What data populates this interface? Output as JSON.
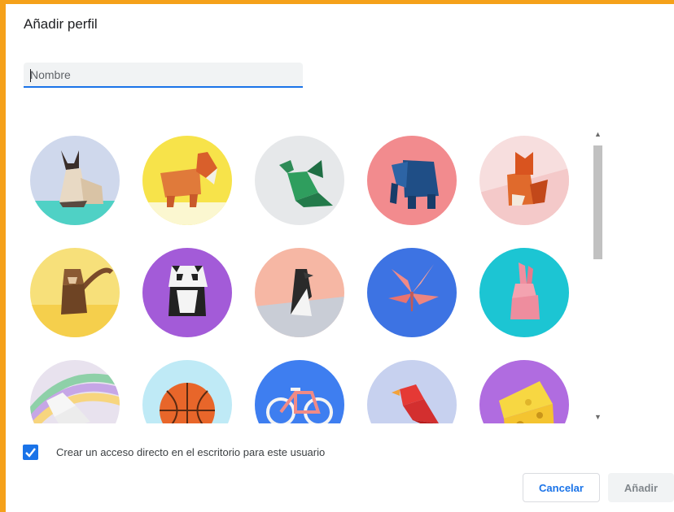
{
  "dialog": {
    "title": "Añadir perfil",
    "name_field": {
      "placeholder": "Nombre",
      "value": ""
    }
  },
  "avatar_grid": {
    "avatars": [
      {
        "icon": "origami-cat-icon",
        "background": "#cfd8ec"
      },
      {
        "icon": "origami-corgi-icon",
        "background": "#f7e34a"
      },
      {
        "icon": "origami-dragon-icon",
        "background": "#e6e8ea"
      },
      {
        "icon": "origami-elephant-icon",
        "background": "#f28b8e"
      },
      {
        "icon": "origami-fox-icon",
        "background": "#f7dede"
      },
      {
        "icon": "origami-monkey-icon",
        "background": "#f7e07a"
      },
      {
        "icon": "origami-panda-icon",
        "background": "#a35bd8"
      },
      {
        "icon": "origami-penguin-icon",
        "background": "#f6b7a4"
      },
      {
        "icon": "origami-butterfly-icon",
        "background": "#3d73e3"
      },
      {
        "icon": "origami-rabbit-icon",
        "background": "#1cc5d3"
      },
      {
        "icon": "origami-unicorn-icon",
        "background": "#e8e2ee"
      },
      {
        "icon": "origami-basketball-icon",
        "background": "#bfeaf6"
      },
      {
        "icon": "origami-bicycle-icon",
        "background": "#3e7ef0"
      },
      {
        "icon": "origami-bird-icon",
        "background": "#c7d1ef"
      },
      {
        "icon": "origami-cheese-icon",
        "background": "#b06ce0"
      }
    ]
  },
  "shortcut": {
    "checked": true,
    "label": "Crear un acceso directo en el escritorio para este usuario"
  },
  "buttons": {
    "cancel_label": "Cancelar",
    "add_label": "Añadir"
  },
  "colors": {
    "accent": "#1a73e8",
    "frame": "#f5a11a"
  }
}
